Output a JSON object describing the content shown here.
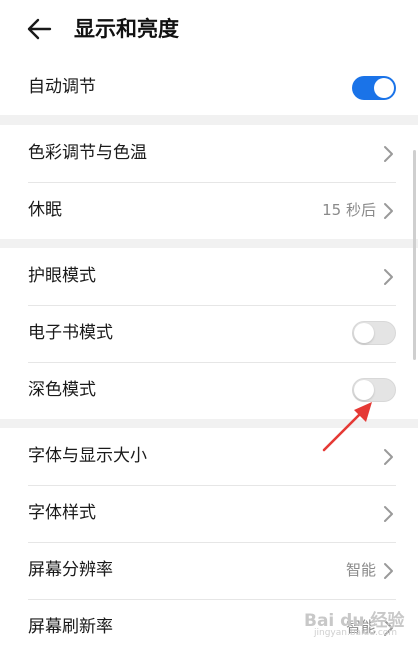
{
  "header": {
    "title": "显示和亮度",
    "back_icon": "arrow-left-icon"
  },
  "auto_adjust": {
    "label": "自动调节",
    "enabled": true
  },
  "group1": {
    "items": [
      {
        "label": "色彩调节与色温",
        "value": ""
      },
      {
        "label": "休眠",
        "value": "15 秒后"
      }
    ]
  },
  "group2": {
    "eye_comfort": {
      "label": "护眼模式"
    },
    "ebook": {
      "label": "电子书模式",
      "enabled": false
    },
    "dark_mode": {
      "label": "深色模式",
      "enabled": false
    }
  },
  "group3": {
    "items": [
      {
        "label": "字体与显示大小",
        "value": ""
      },
      {
        "label": "字体样式",
        "value": ""
      },
      {
        "label": "屏幕分辨率",
        "value": "智能"
      },
      {
        "label": "屏幕刷新率",
        "value": "智能"
      }
    ]
  },
  "watermark": {
    "text": "Bai du 经验",
    "sub": "jingyan.baidu.com"
  },
  "colors": {
    "accent": "#1a73e8",
    "annotation_arrow": "#e53935"
  }
}
